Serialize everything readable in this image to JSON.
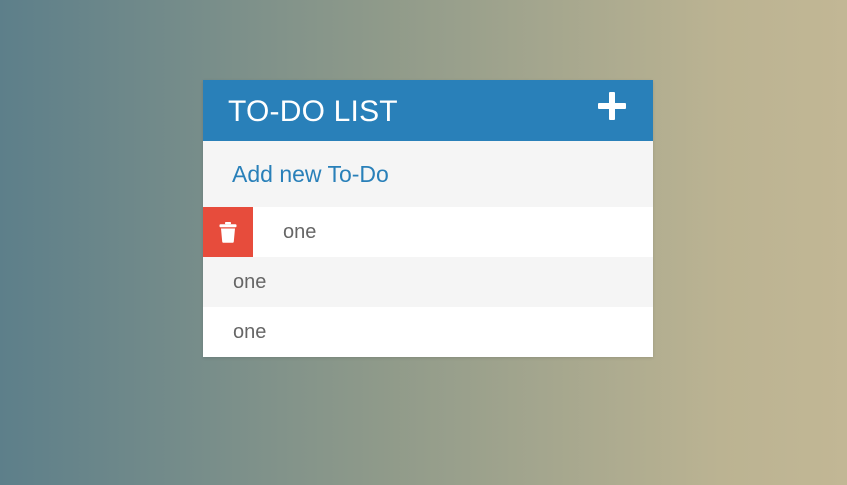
{
  "header": {
    "title": "TO-DO LIST",
    "add_icon": "plus-icon"
  },
  "new_todo": {
    "placeholder": "Add new To-Do",
    "value": ""
  },
  "todos": [
    {
      "text": "one",
      "delete_visible": true,
      "delete_icon": "trash-icon"
    },
    {
      "text": "one",
      "delete_visible": false
    },
    {
      "text": "one",
      "delete_visible": false
    }
  ],
  "colors": {
    "accent": "#2980b9",
    "delete": "#e74c3c",
    "row_alt": "#f5f5f5",
    "text": "#666666"
  }
}
